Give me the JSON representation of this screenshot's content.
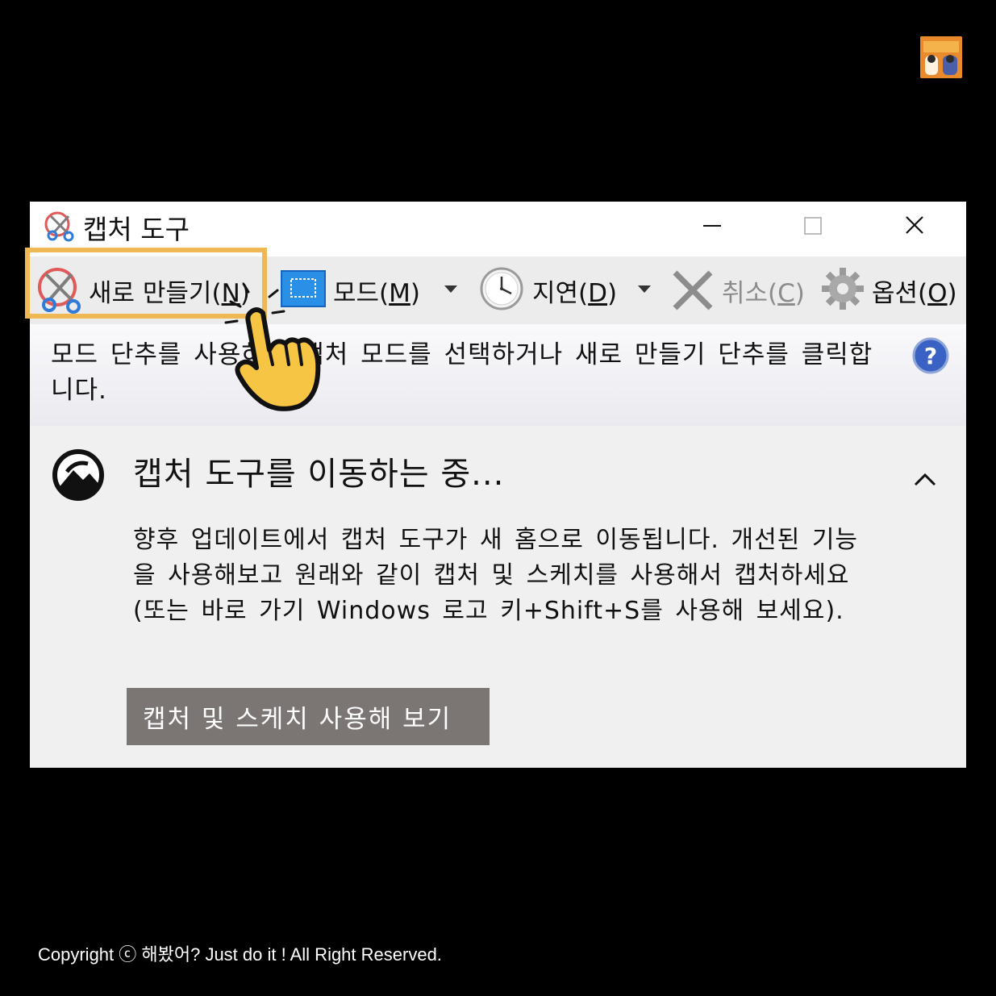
{
  "window": {
    "title": "캡처 도구"
  },
  "toolbar": {
    "new_label": "새로 만들기(N)",
    "mode_label": "모드(M)",
    "delay_label": "지연(D)",
    "cancel_label": "취소(C)",
    "options_label": "옵션(O)"
  },
  "info": {
    "text": "모드 단추를 사용하여 캡처 모드를 선택하거나 새로 만들기 단추를 클릭합니다."
  },
  "notice": {
    "title": "캡처 도구를 이동하는 중...",
    "body": "향후 업데이트에서 캡처 도구가 새 홈으로 이동됩니다. 개선된 기능을 사용해보고 원래와 같이 캡처 및 스케치를 사용해서 캡처하세요(또는 바로 가기 Windows 로고 키+Shift+S를 사용해 보세요).",
    "button_label": "캡처 및 스케치 사용해 보기"
  },
  "footer": {
    "copyright": "Copyright ⓒ 해봤어? Just do it ! All Right Reserved."
  },
  "colors": {
    "highlight": "#f0b855",
    "button_bg": "#7b7574",
    "hand": "#f6c544"
  }
}
